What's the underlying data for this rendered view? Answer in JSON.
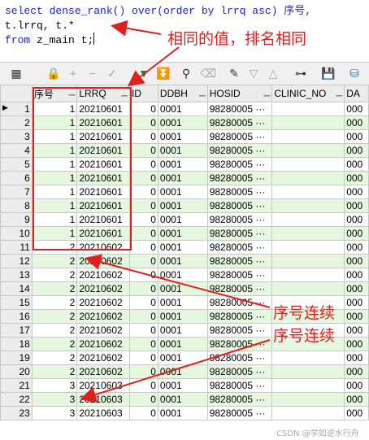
{
  "editor": {
    "line1_kw": "select",
    "line1_rest": "dense_rank() over(order by lrrq asc) 序号,",
    "line2": "t.lrrq, t.*",
    "line3_kw": "from",
    "line3_rest": "z_main t;"
  },
  "annotations": {
    "top": "相同的值，排名相同",
    "mid1": "序号连续",
    "mid2": "序号连续",
    "watermark": "CSDN @学如逆水行舟"
  },
  "colors": {
    "annotation": "#e0201c",
    "row_alt": "#e5f7df",
    "keyword": "#1b22c4"
  },
  "toolbar": {
    "icons": [
      "grid-icon",
      "lock-icon",
      "add-icon",
      "remove-icon",
      "check-icon",
      "arrow-down-icon",
      "arrow-down-all-icon",
      "binoculars-icon",
      "eraser-icon",
      "edit-icon",
      "triangle-down-icon",
      "triangle-up-icon",
      "tree-icon",
      "save-icon",
      "database-icon"
    ]
  },
  "grid": {
    "columns": [
      "序号",
      "LRRQ",
      "ID",
      "DDBH",
      "HOSID",
      "CLINIC_NO",
      "DA"
    ],
    "rows": [
      {
        "n": "1",
        "seq": "1",
        "lrrq": "20210601",
        "id": "0",
        "ddbh": "0001",
        "hosid": "98280005",
        "da": "000"
      },
      {
        "n": "2",
        "seq": "1",
        "lrrq": "20210601",
        "id": "0",
        "ddbh": "0001",
        "hosid": "98280005",
        "da": "000"
      },
      {
        "n": "3",
        "seq": "1",
        "lrrq": "20210601",
        "id": "0",
        "ddbh": "0001",
        "hosid": "98280005",
        "da": "000"
      },
      {
        "n": "4",
        "seq": "1",
        "lrrq": "20210601",
        "id": "0",
        "ddbh": "0001",
        "hosid": "98280005",
        "da": "000"
      },
      {
        "n": "5",
        "seq": "1",
        "lrrq": "20210601",
        "id": "0",
        "ddbh": "0001",
        "hosid": "98280005",
        "da": "000"
      },
      {
        "n": "6",
        "seq": "1",
        "lrrq": "20210601",
        "id": "0",
        "ddbh": "0001",
        "hosid": "98280005",
        "da": "000"
      },
      {
        "n": "7",
        "seq": "1",
        "lrrq": "20210601",
        "id": "0",
        "ddbh": "0001",
        "hosid": "98280005",
        "da": "000"
      },
      {
        "n": "8",
        "seq": "1",
        "lrrq": "20210601",
        "id": "0",
        "ddbh": "0001",
        "hosid": "98280005",
        "da": "000"
      },
      {
        "n": "9",
        "seq": "1",
        "lrrq": "20210601",
        "id": "0",
        "ddbh": "0001",
        "hosid": "98280005",
        "da": "000"
      },
      {
        "n": "10",
        "seq": "1",
        "lrrq": "20210601",
        "id": "0",
        "ddbh": "0001",
        "hosid": "98280005",
        "da": "000"
      },
      {
        "n": "11",
        "seq": "2",
        "lrrq": "20210602",
        "id": "0",
        "ddbh": "0001",
        "hosid": "98280005",
        "da": "000"
      },
      {
        "n": "12",
        "seq": "2",
        "lrrq": "20210602",
        "id": "0",
        "ddbh": "0001",
        "hosid": "98280005",
        "da": "000"
      },
      {
        "n": "13",
        "seq": "2",
        "lrrq": "20210602",
        "id": "0",
        "ddbh": "0001",
        "hosid": "98280005",
        "da": "000"
      },
      {
        "n": "14",
        "seq": "2",
        "lrrq": "20210602",
        "id": "0",
        "ddbh": "0001",
        "hosid": "98280005",
        "da": "000"
      },
      {
        "n": "15",
        "seq": "2",
        "lrrq": "20210602",
        "id": "0",
        "ddbh": "0001",
        "hosid": "98280005",
        "da": "000"
      },
      {
        "n": "16",
        "seq": "2",
        "lrrq": "20210602",
        "id": "0",
        "ddbh": "0001",
        "hosid": "98280005",
        "da": "000"
      },
      {
        "n": "17",
        "seq": "2",
        "lrrq": "20210602",
        "id": "0",
        "ddbh": "0001",
        "hosid": "98280005",
        "da": "000"
      },
      {
        "n": "18",
        "seq": "2",
        "lrrq": "20210602",
        "id": "0",
        "ddbh": "0001",
        "hosid": "98280005",
        "da": "000"
      },
      {
        "n": "19",
        "seq": "2",
        "lrrq": "20210602",
        "id": "0",
        "ddbh": "0001",
        "hosid": "98280005",
        "da": "000"
      },
      {
        "n": "20",
        "seq": "2",
        "lrrq": "20210602",
        "id": "0",
        "ddbh": "0001",
        "hosid": "98280005",
        "da": "000"
      },
      {
        "n": "21",
        "seq": "3",
        "lrrq": "20210603",
        "id": "0",
        "ddbh": "0001",
        "hosid": "98280005",
        "da": "000"
      },
      {
        "n": "22",
        "seq": "3",
        "lrrq": "20210603",
        "id": "0",
        "ddbh": "0001",
        "hosid": "98280005",
        "da": "000"
      },
      {
        "n": "23",
        "seq": "3",
        "lrrq": "20210603",
        "id": "0",
        "ddbh": "0001",
        "hosid": "98280005",
        "da": "000"
      }
    ]
  }
}
